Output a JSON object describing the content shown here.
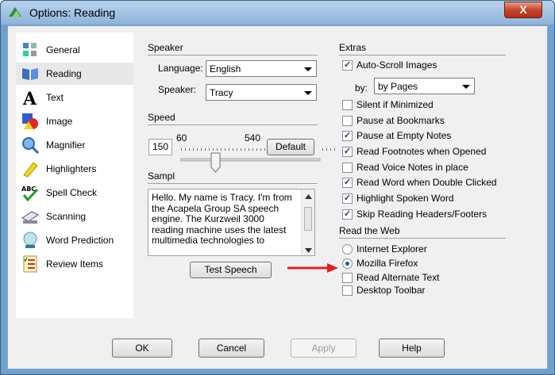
{
  "window": {
    "title": "Options: Reading",
    "close_label": "X"
  },
  "sidebar": {
    "items": [
      {
        "label": "General",
        "icon": "general-icon"
      },
      {
        "label": "Reading",
        "icon": "reading-icon",
        "selected": true
      },
      {
        "label": "Text",
        "icon": "text-icon"
      },
      {
        "label": "Image",
        "icon": "image-icon"
      },
      {
        "label": "Magnifier",
        "icon": "magnifier-icon"
      },
      {
        "label": "Highlighters",
        "icon": "highlighter-icon"
      },
      {
        "label": "Spell Check",
        "icon": "spell-check-icon"
      },
      {
        "label": "Scanning",
        "icon": "scanner-icon"
      },
      {
        "label": "Word Prediction",
        "icon": "crystal-ball-icon"
      },
      {
        "label": "Review Items",
        "icon": "review-list-icon"
      }
    ]
  },
  "speaker": {
    "title": "Speaker",
    "language_label": "Language:",
    "language_value": "English",
    "speaker_label": "Speaker:",
    "speaker_value": "Tracy"
  },
  "speed": {
    "title": "Speed",
    "value": "150",
    "tick_min": "60",
    "tick_max": "540",
    "default_label": "Default"
  },
  "sample": {
    "title": "Sampl",
    "text": "Hello. My name is Tracy. I'm from the Acapela Group SA speech engine. The Kurzweil 3000 reading machine uses the latest multimedia technologies to",
    "test_label": "Test Speech"
  },
  "extras": {
    "title": "Extras",
    "auto_scroll": {
      "label": "Auto-Scroll Images",
      "checked": true
    },
    "by_label": "by:",
    "by_value": "by Pages",
    "options": [
      {
        "label": "Silent if Minimized",
        "checked": false
      },
      {
        "label": "Pause at Bookmarks",
        "checked": false
      },
      {
        "label": "Pause at Empty Notes",
        "checked": true
      },
      {
        "label": "Read Footnotes when Opened",
        "checked": true
      },
      {
        "label": "Read Voice Notes in place",
        "checked": false
      },
      {
        "label": "Read Word when Double Clicked",
        "checked": true
      },
      {
        "label": "Highlight Spoken Word",
        "checked": true
      },
      {
        "label": "Skip Reading Headers/Footers",
        "checked": true
      }
    ]
  },
  "web": {
    "title": "Read the Web",
    "radios": [
      {
        "label": "Internet Explorer",
        "selected": false
      },
      {
        "label": "Mozilla Firefox",
        "selected": true
      }
    ],
    "checks": [
      {
        "label": "Read Alternate Text",
        "checked": false
      },
      {
        "label": "Desktop Toolbar",
        "checked": false
      }
    ]
  },
  "footer": {
    "ok": "OK",
    "cancel": "Cancel",
    "apply": "Apply",
    "help": "Help"
  },
  "colors": {
    "accent": "#1c57b0",
    "annotation": "#e02020",
    "title_bar": "#8db3db"
  }
}
